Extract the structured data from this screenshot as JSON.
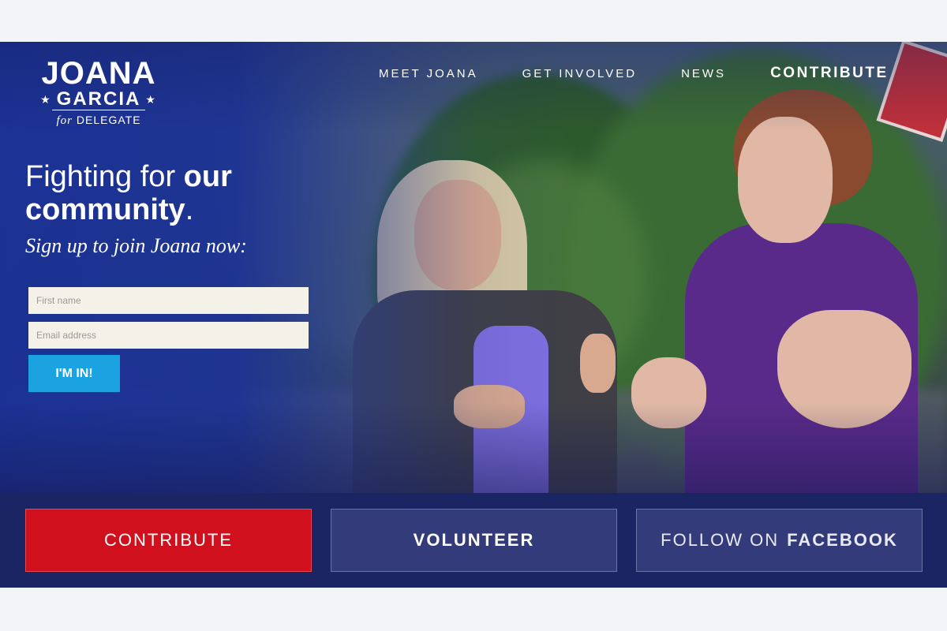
{
  "logo": {
    "name_line1": "JOANA",
    "name_line2": "GARCIA",
    "tagline_prefix": "for",
    "tagline_suffix": "DELEGATE",
    "star": "★"
  },
  "nav": {
    "items": [
      "MEET JOANA",
      "GET INVOLVED",
      "NEWS",
      "CONTRIBUTE"
    ]
  },
  "hero": {
    "headline_part1": "Fighting for ",
    "headline_bold1": "our",
    "headline_bold2": "community",
    "headline_end": ".",
    "subhead": "Sign up to join Joana now:"
  },
  "form": {
    "first_name_placeholder": "First name",
    "email_placeholder": "Email address",
    "submit_label": "I'M IN!"
  },
  "cta": {
    "contribute": "CONTRIBUTE",
    "volunteer": "VOLUNTEER",
    "facebook_prefix": "FOLLOW ON",
    "facebook_bold": "FACEBOOK"
  },
  "colors": {
    "brand_blue": "#1d2a6a",
    "accent_red": "#d0101c",
    "button_blue": "#1aa3e0"
  }
}
